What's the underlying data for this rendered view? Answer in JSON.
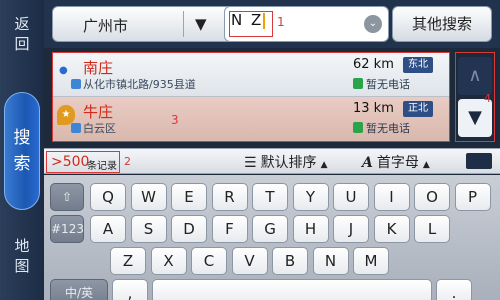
{
  "rail": {
    "back_label": "返回",
    "search_label": "搜索",
    "map_label": "地图"
  },
  "topbar": {
    "city": "广州市",
    "city_dropdown_glyph": "▼",
    "query_value": "N Z",
    "query_annotation": "1",
    "query_clear_glyph": "⌄",
    "other_search_label": "其他搜索"
  },
  "results": [
    {
      "name": "南庄",
      "distance": "62 km",
      "direction": "东北",
      "address": "从化市镇北路/935县道",
      "phone": "暂无电话"
    },
    {
      "name": "牛庄",
      "distance": "13 km",
      "direction": "正北",
      "address": "白云区",
      "phone": "暂无电话"
    }
  ],
  "results_annotation": "3",
  "scroll": {
    "up_glyph": "∧",
    "down_glyph": "▼",
    "annotation": "4"
  },
  "sortbar": {
    "count_value": ">500",
    "count_label": "条记录",
    "count_annotation": "2",
    "sort_default_label": "默认排序",
    "sort_alpha_label": "首字母",
    "sort_icon": "☰",
    "alpha_icon": "A",
    "triangle": "▲"
  },
  "keyboard": {
    "row1": [
      "Q",
      "W",
      "E",
      "R",
      "T",
      "Y",
      "U",
      "I",
      "O",
      "P"
    ],
    "row2": [
      "#123",
      "A",
      "S",
      "D",
      "F",
      "G",
      "H",
      "J",
      "K",
      "L"
    ],
    "row3": [
      "Z",
      "X",
      "C",
      "V",
      "B",
      "N",
      "M"
    ],
    "row4": [
      "中/英",
      ",",
      "."
    ],
    "shift_glyph": "⇧"
  },
  "colors": {
    "accent_red": "#d12a1a",
    "annotation_red": "#d83a3a",
    "nav_active": "#1b58b2"
  }
}
